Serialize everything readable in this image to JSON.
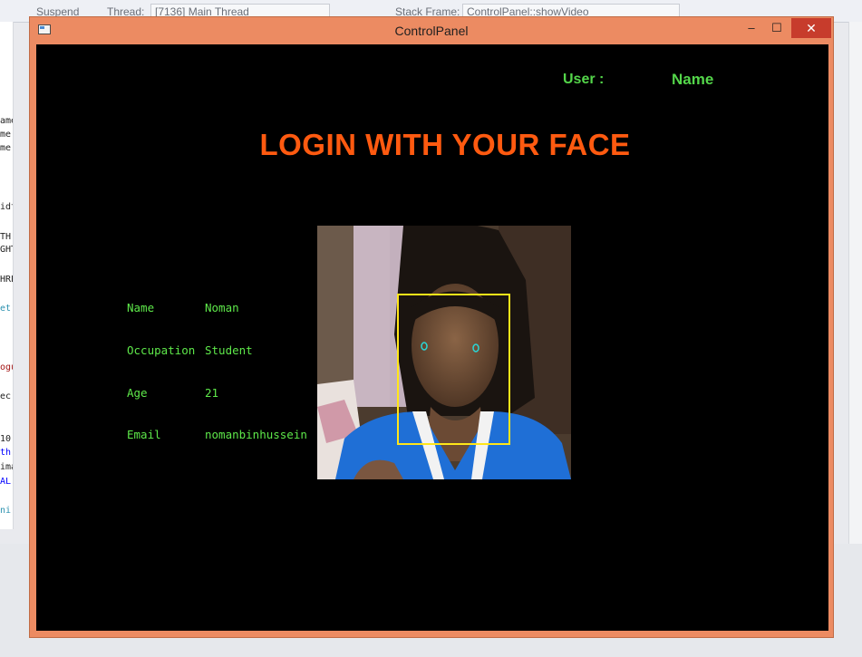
{
  "background": {
    "toolbar": {
      "suspend_label": "Suspend",
      "thread_label": "Thread:",
      "thread_value": "[7136] Main Thread",
      "stack_frame_label": "Stack Frame:",
      "stack_frame_value": "ControlPanel::showVideo"
    },
    "code_fragments": [
      "ame",
      "me",
      "me",
      "idt",
      "TH",
      "GHT",
      "HRE",
      "et",
      "ogu",
      "ec",
      "10",
      "th",
      "ima",
      "AL",
      "ni"
    ]
  },
  "window": {
    "title": "ControlPanel",
    "minimize_glyph": "–",
    "maximize_glyph": "☐",
    "close_glyph": "✕",
    "frame_color": "#ec8b62",
    "client_color": "#000000"
  },
  "header": {
    "user_label": "User :",
    "user_name": "Name",
    "accent": "#54d64a"
  },
  "headline": {
    "text": "LOGIN WITH YOUR FACE",
    "color": "#ff5a10"
  },
  "profile": [
    {
      "label": "Name",
      "value": "Noman"
    },
    {
      "label": "Occupation",
      "value": "Student"
    },
    {
      "label": "Age",
      "value": "21"
    },
    {
      "label": "Email",
      "value": "nomanbinhussein"
    }
  ],
  "camera": {
    "face_box_color": "#ffe619",
    "eye_marker_color": "#2ad6d6"
  }
}
